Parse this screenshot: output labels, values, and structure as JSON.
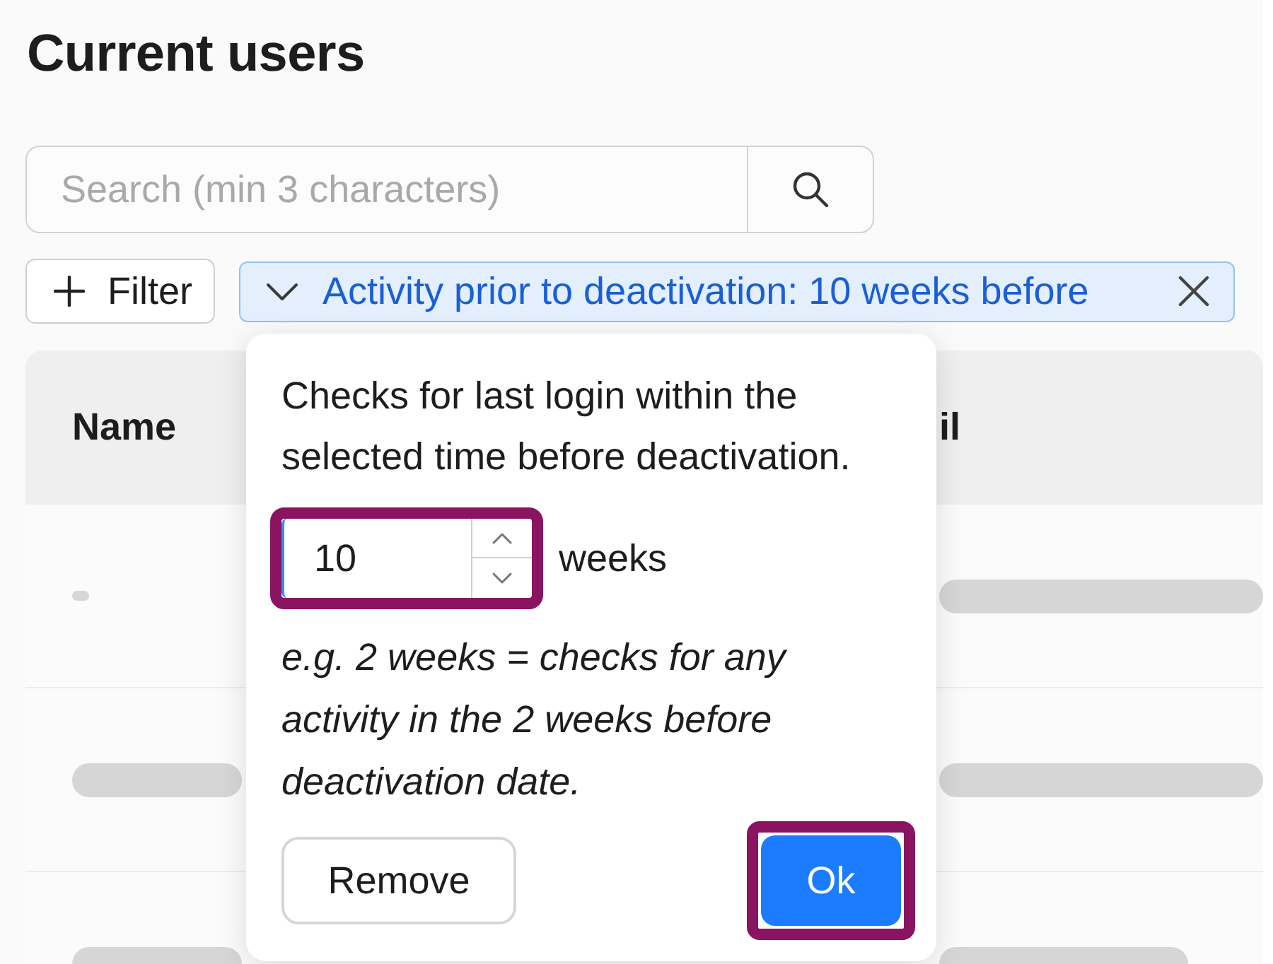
{
  "page": {
    "title": "Current users"
  },
  "search": {
    "placeholder": "Search (min 3 characters)"
  },
  "filter_button": {
    "label": "Filter"
  },
  "active_filter": {
    "label": "Activity prior to deactivation: 10 weeks before"
  },
  "table": {
    "columns": {
      "name": "Name",
      "column_2": "il"
    },
    "rows": [
      {
        "blurred": true
      },
      {
        "blurred": true
      },
      {
        "blurred": true
      }
    ]
  },
  "popover": {
    "description": "Checks for last login within the selected time before deactivation.",
    "number_input": {
      "value": "10",
      "highlighted": true
    },
    "unit": "weeks",
    "example": "e.g. 2 weeks = checks for any activity in the 2 weeks before deactivation date.",
    "buttons": [
      {
        "label": "Remove",
        "kind": "secondary",
        "highlighted": false
      },
      {
        "label": "Ok",
        "kind": "primary",
        "highlighted": true
      }
    ]
  }
}
